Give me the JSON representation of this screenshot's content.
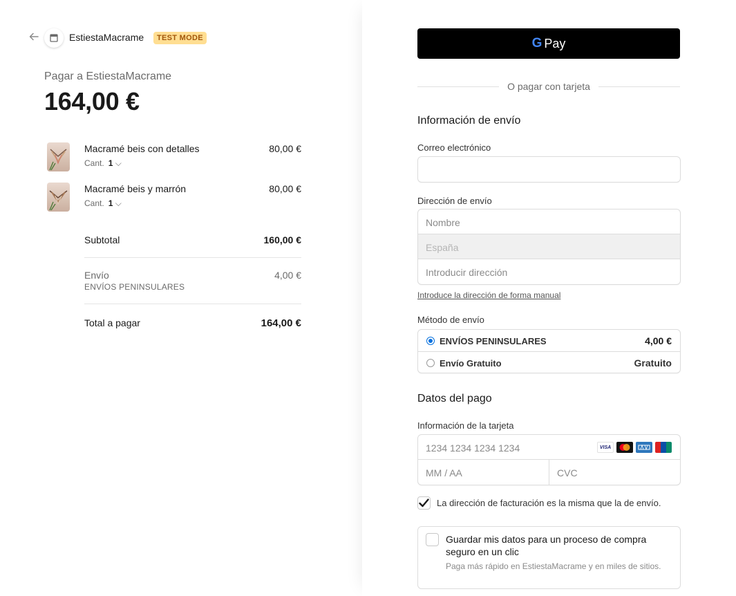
{
  "header": {
    "store_name": "EstiestaMacrame",
    "test_badge": "TEST MODE"
  },
  "summary": {
    "pay_to": "Pagar a EstiestaMacrame",
    "amount": "164,00 €",
    "items": [
      {
        "name": "Macramé beis con detalles",
        "qty_label": "Cant.",
        "qty": "1",
        "price": "80,00 €"
      },
      {
        "name": "Macramé beis y marrón",
        "qty_label": "Cant.",
        "qty": "1",
        "price": "80,00 €"
      }
    ],
    "subtotal_label": "Subtotal",
    "subtotal_value": "160,00 €",
    "shipping_label": "Envío",
    "shipping_method": "ENVÍOS PENINSULARES",
    "shipping_value": "4,00 €",
    "total_label": "Total a pagar",
    "total_value": "164,00 €"
  },
  "payment": {
    "gpay_label": "Pay",
    "or_card": "O pagar con tarjeta",
    "shipping_info_title": "Información de envío",
    "email_label": "Correo electrónico",
    "email_value": "",
    "address_label": "Dirección de envío",
    "name_placeholder": "Nombre",
    "country_value": "España",
    "address_placeholder": "Introducir dirección",
    "manual_link": "Introduce la dirección de forma manual",
    "method_label": "Método de envío",
    "methods": [
      {
        "name": "ENVÍOS PENINSULARES",
        "price": "4,00 €",
        "selected": true
      },
      {
        "name": "Envío Gratuito",
        "price": "Gratuito",
        "selected": false
      }
    ],
    "payment_data_title": "Datos del pago",
    "card_info_label": "Información de la tarjeta",
    "card_number_placeholder": "1234 1234 1234 1234",
    "expiry_placeholder": "MM / AA",
    "cvc_placeholder": "CVC",
    "card_brands": [
      "VISA",
      "mastercard-icon",
      "amex-icon",
      "unionpay-icon"
    ],
    "billing_same_label": "La dirección de facturación es la misma que la de envío.",
    "billing_same_checked": true,
    "save_title": "Guardar mis datos para un proceso de compra seguro en un clic",
    "save_sub": "Paga más rápido en EstiestaMacrame y en miles de sitios."
  },
  "colors": {
    "accent": "#0570de",
    "test_badge_bg": "#ffde92",
    "test_badge_text": "#a1570c"
  }
}
